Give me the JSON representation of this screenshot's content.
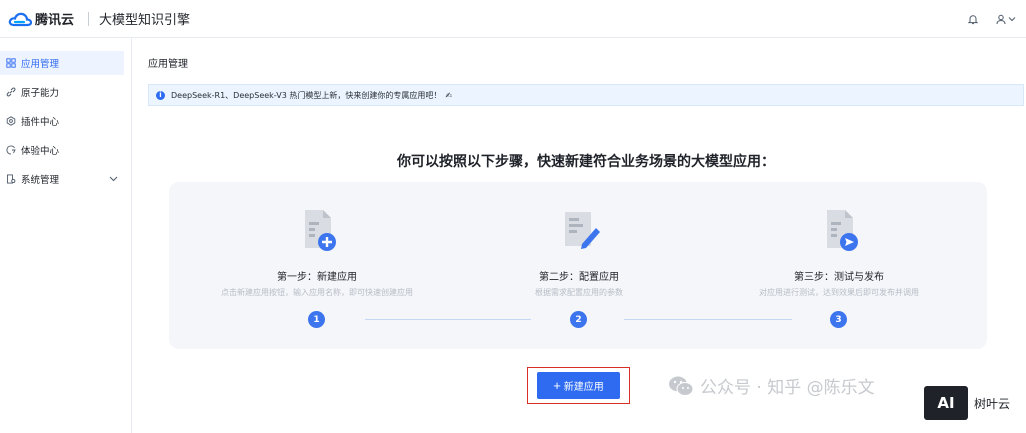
{
  "header": {
    "brand": "腾讯云",
    "product": "大模型知识引擎",
    "bell_icon": "bell-icon",
    "user_icon": "user-icon"
  },
  "sidebar": {
    "items": [
      {
        "label": "应用管理",
        "icon": "grid-icon",
        "active": true
      },
      {
        "label": "原子能力",
        "icon": "link-icon",
        "active": false
      },
      {
        "label": "插件中心",
        "icon": "hexagon-icon",
        "active": false
      },
      {
        "label": "体验中心",
        "icon": "compass-icon",
        "active": false
      },
      {
        "label": "系统管理",
        "icon": "doc-settings-icon",
        "active": false,
        "expandable": true
      }
    ]
  },
  "main": {
    "page_title": "应用管理",
    "notice": {
      "text": "DeepSeek-R1、DeepSeek-V3 热门模型上新，快来创建你的专属应用吧！",
      "icon": "info-icon"
    },
    "headline": "你可以按照以下步骤，快速新建符合业务场景的大模型应用：",
    "steps": [
      {
        "num": "1",
        "title": "第一步：新建应用",
        "desc": "点击新建应用按钮，输入应用名称，即可快速创建应用",
        "icon": "doc-add-icon"
      },
      {
        "num": "2",
        "title": "第二步：配置应用",
        "desc": "根据需求配置应用的参数",
        "icon": "doc-edit-icon"
      },
      {
        "num": "3",
        "title": "第三步：测试与发布",
        "desc": "对应用进行测试，达到效果后即可发布并调用",
        "icon": "doc-send-icon"
      }
    ],
    "new_button": "新建应用"
  },
  "watermark": {
    "text": "公众号 · 知乎 @陈乐文",
    "brand": "树叶云",
    "badge": "AI"
  },
  "colors": {
    "accent": "#2e6bf0",
    "highlight_frame": "#d93026",
    "notice_bg": "#ebf4ff"
  }
}
